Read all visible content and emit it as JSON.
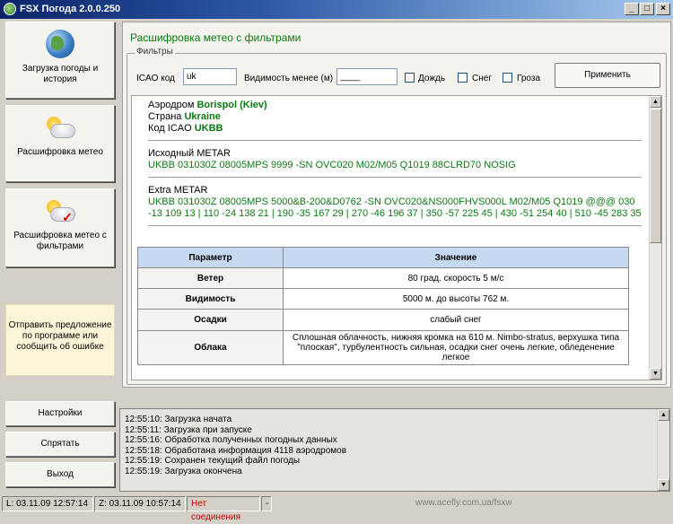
{
  "window": {
    "title": "FSX Погода 2.0.0.250"
  },
  "nav": {
    "load_weather": "Загрузка погоды и история",
    "decode": "Расшифровка метео",
    "decode_filtered": "Расшифровка метео с фильтрами",
    "feedback": "Отправить предложение по программе или сообщить об ошибке",
    "settings": "Настройки",
    "hide": "Спрятать",
    "exit": "Выход"
  },
  "main": {
    "title": "Расшифровка метео с фильтрами",
    "filters": {
      "legend": "Фильтры",
      "icao_label": "ICAO код",
      "icao_value": "uk",
      "visibility_label": "Видимость менее (м)",
      "visibility_value": "____",
      "rain": "Дождь",
      "snow": "Снег",
      "storm": "Гроза",
      "apply": "Применить"
    },
    "report": {
      "airport_label": "Аэродром",
      "airport_value": "Borispol (Kiev)",
      "country_label": "Страна",
      "country_value": "Ukraine",
      "icao_label": "Код ICAO",
      "icao_value": "UKBB",
      "metar_label": "Исходный METAR",
      "metar_value": "UKBB 031030Z 08005MPS 9999 -SN OVC020 M02/M05 Q1019 88CLRD70 NOSIG",
      "extra_label": "Extra METAR",
      "extra_value": "UKBB 031030Z 08005MPS 5000&B-200&D0762 -SN OVC020&NS000FHVS000L M02/M05 Q1019 @@@ 030 -13 109 13 | 110 -24 138 21 | 190 -35 167 29 | 270 -46 196 37 | 350 -57 225 45 | 430 -51 254 40 | 510 -45 283 35",
      "table": {
        "headers": [
          "Параметр",
          "Значение"
        ],
        "rows": [
          [
            "Ветер",
            "80 град. скорость 5 м/с"
          ],
          [
            "Видимость",
            "5000 м. до высоты 762 м."
          ],
          [
            "Осадки",
            "слабый снег"
          ],
          [
            "Облака",
            "Сплошная облачность, нижняя кромка на 610 м. Nimbo-stratus, верхушка типа \"плоская\", турбулентность сильная, осадки снег очень легкие, обледенение легкое"
          ]
        ]
      }
    }
  },
  "log": [
    "12:55:10: Загрузка начата",
    "12:55:11: Загрузка при запуске",
    "12:55:16: Обработка полученных погодных данных",
    "12:55:18: Обработана информация 4118 аэродромов",
    "12:55:19: Сохранен текущий файл погоды",
    "12:55:19: Загрузка окончена"
  ],
  "status": {
    "local": "L: 03.11.09 12:57:14",
    "zulu": "Z: 03.11.09 10:57:14",
    "connection": "Нет соединения",
    "dash": "-",
    "url": "www.acefly.com.ua/fsxw"
  }
}
